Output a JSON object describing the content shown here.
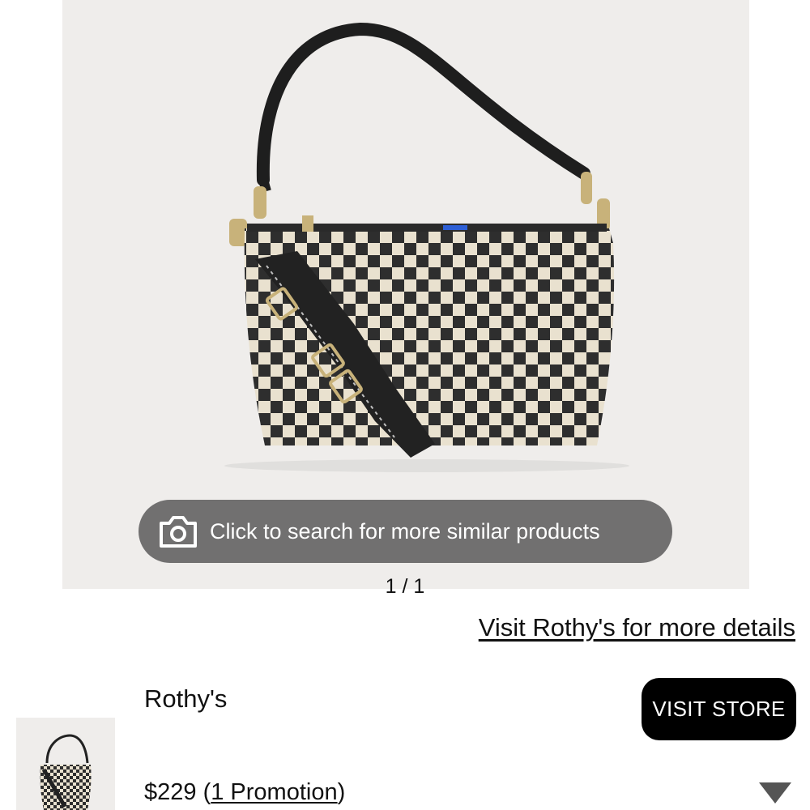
{
  "hero": {
    "image_alt": "Checkered shoulder bag with black strap",
    "search_prompt": "Click to search for more similar products",
    "search_icon": "camera-icon"
  },
  "pagination": {
    "current": "1",
    "separator": "/",
    "total": "1",
    "label": "1 / 1"
  },
  "visit_link": "Visit Rothy's for more details",
  "product": {
    "brand": "Rothy's",
    "price": "$229",
    "promotion_open": " (",
    "promotion_label": "1 Promotion",
    "promotion_close": ")"
  },
  "visit_store_button": "VISIT STORE",
  "expand_icon": "triangle-down-icon",
  "colors": {
    "hero_bg": "#efedeb",
    "pill_bg": "#696969",
    "button_bg": "#000000",
    "text": "#111111",
    "bag_light": "#e9e1cf",
    "bag_dark": "#2e2e2e"
  }
}
